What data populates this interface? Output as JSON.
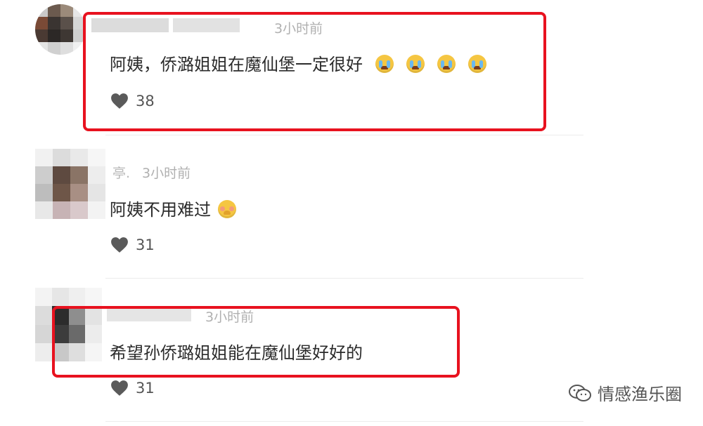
{
  "comments": [
    {
      "time": "3小时前",
      "text": "阿姨，侨潞姐姐在魔仙堡一定很好",
      "emojis": [
        "crying-face-icon",
        "crying-face-icon",
        "crying-face-icon",
        "crying-face-icon"
      ],
      "likes": "38",
      "highlighted": true
    },
    {
      "name_partial": "亭.",
      "time": "3小时前",
      "text": "阿姨不用难过",
      "emojis": [
        "shy-hands-face-icon"
      ],
      "likes": "31",
      "highlighted": false
    },
    {
      "time": "3小时前",
      "text": "希望孙侨璐姐姐能在魔仙堡好好的",
      "emojis": [],
      "likes": "31",
      "highlighted": true
    }
  ],
  "watermark": {
    "text": "情感渔乐圈",
    "icon": "wechat-official-account-icon"
  },
  "colors": {
    "highlight": "#e8121f",
    "time": "#b0b0b0",
    "heart": "#5a5a5a"
  }
}
